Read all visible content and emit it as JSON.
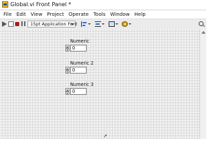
{
  "window": {
    "title": "Global.vi Front Panel *"
  },
  "menu": [
    "File",
    "Edit",
    "View",
    "Project",
    "Operate",
    "Tools",
    "Window",
    "Help"
  ],
  "toolbar": {
    "font_selector": "15pt Application Font",
    "icons": [
      "run-arrow-icon",
      "run-continuously-icon",
      "abort-icon",
      "pause-icon",
      "align-objects-icon",
      "distribute-objects-icon",
      "resize-objects-icon",
      "reorder-icon",
      "search-icon"
    ]
  },
  "panel": {
    "controls": [
      {
        "label": "Numeric",
        "value": "0"
      },
      {
        "label": "Numeric 2",
        "value": "0"
      },
      {
        "label": "Numeric 3",
        "value": "0"
      }
    ]
  },
  "colors": {
    "panel_bg": "#f2f2f2",
    "grid": "#dcdcdc",
    "toolbar_bg": "#ebebeb",
    "stop": "#a31e1e"
  }
}
